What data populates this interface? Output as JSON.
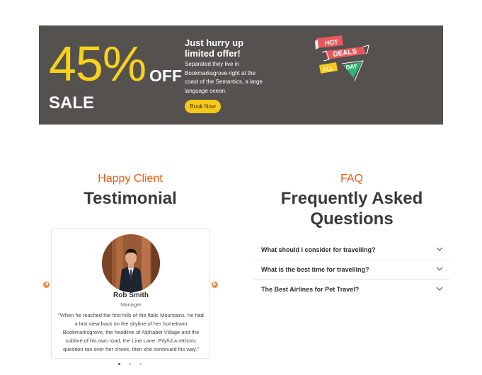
{
  "banner": {
    "discount": "45%",
    "off_label": "OFF",
    "sale_label": "SALE",
    "offer_title": "Just hurry up limited offer!",
    "offer_text": "Separated they live in Bookmarksgrove right at the coast of the Semantics, a large language ocean.",
    "button_label": "Book Now",
    "badge_words": [
      "HOT",
      "DEALS",
      "ALL",
      "DAY"
    ],
    "colors": {
      "background": "#54514f",
      "accent": "#f7d21a",
      "badge_red": "#e8585a",
      "badge_green": "#2fb574"
    }
  },
  "testimonial": {
    "kicker": "Happy Client",
    "title": "Testimonial",
    "client": {
      "name": "Rob Smith",
      "role": "Manager",
      "quote": "\"When he reached the first hills of the Italic Mountains, he had a last view back on the skyline of her hometown Bookmarksgrove, the headline of Alphabet Village and the subline of his own road, the Line Lane. Pityful a rethoric question ran over her cheek, then she continued his way.\""
    },
    "prev_icon": "chevron-left-icon",
    "next_icon": "chevron-right-icon",
    "pagination": {
      "count": 3,
      "active": 1
    }
  },
  "faq": {
    "kicker": "FAQ",
    "title": "Frequently Asked Questions",
    "items": [
      {
        "question": "What should I consider for travelling?"
      },
      {
        "question": "What is the best time for travelling?"
      },
      {
        "question": "The Best Airlines for Pet Travel?"
      }
    ],
    "accent": "#f45a14"
  }
}
